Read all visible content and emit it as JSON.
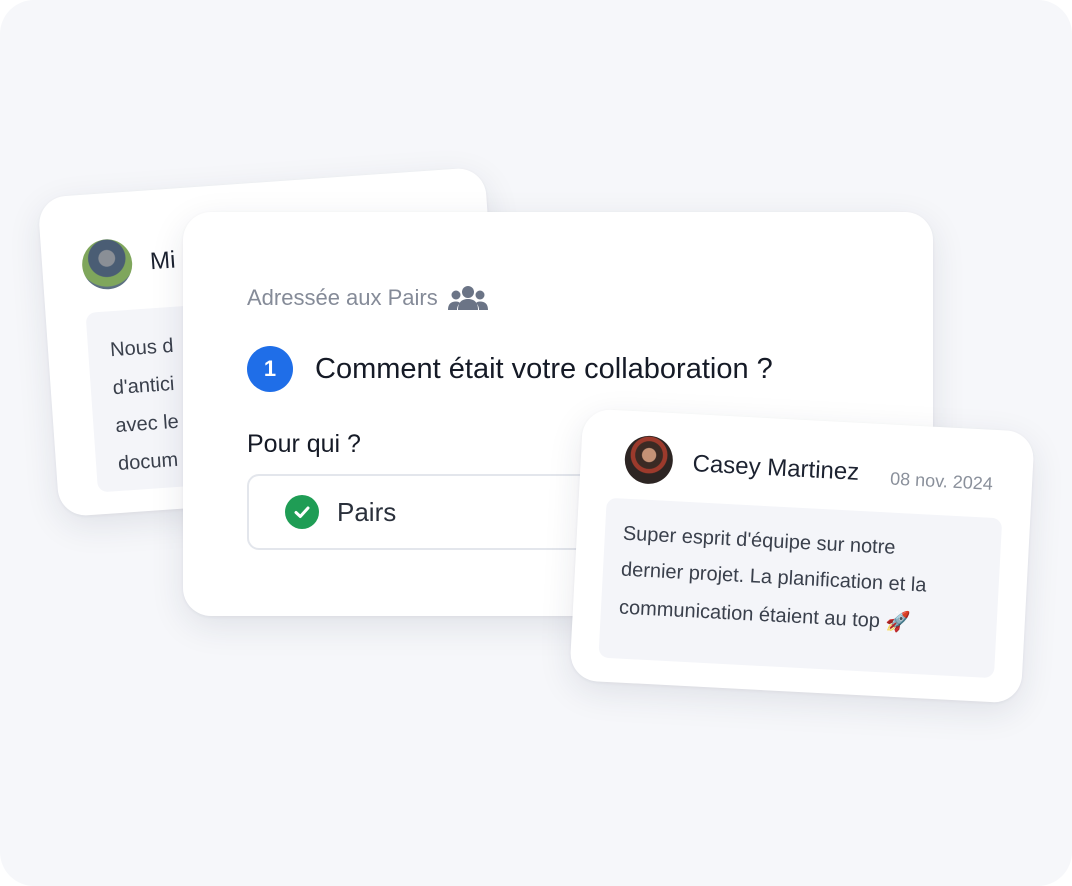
{
  "background_card": {
    "name_partial": "Mi",
    "text_lines": [
      "Nous d",
      "d'antici",
      "avec le",
      "docum"
    ]
  },
  "question_card": {
    "audience_label": "Adressée aux Pairs",
    "audience_icon": "group-icon",
    "question_number": "1",
    "question_text": "Comment était votre collaboration ?",
    "for_label": "Pour qui ?",
    "selected_option": "Pairs",
    "selected_icon": "check-circle-icon"
  },
  "comment_card": {
    "author": "Casey Martinez",
    "date": "08 nov. 2024",
    "text_lines": [
      "Super esprit d'équipe sur notre",
      "dernier projet. La planification et la",
      "communication étaient au top 🚀"
    ]
  },
  "colors": {
    "accent": "#1f6ee8",
    "success": "#1f9d55",
    "background": "#f6f7fa"
  }
}
